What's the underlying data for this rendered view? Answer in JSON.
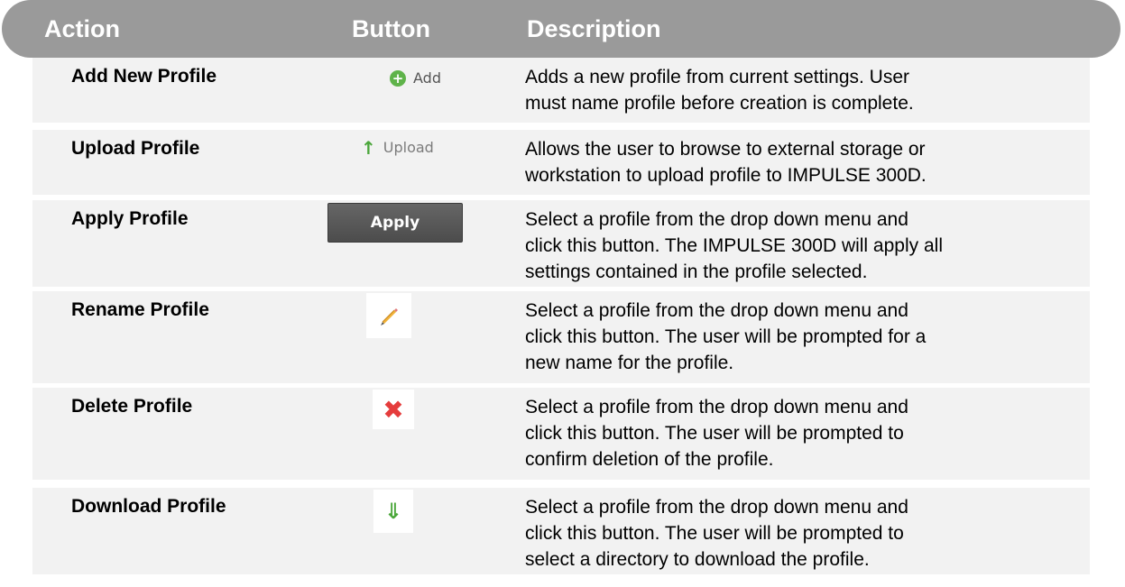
{
  "header": {
    "action": "Action",
    "button": "Button",
    "description": "Description"
  },
  "rows": [
    {
      "action": "Add New Profile",
      "button_label": "Add",
      "button_icon": "plus-circle-icon",
      "description": "Adds a new profile from current settings. User must name profile before creation is complete."
    },
    {
      "action": "Upload Profile",
      "button_label": "Upload",
      "button_icon": "arrow-up-icon",
      "description": "Allows the user to browse to external storage or workstation to upload profile to IMPULSE 300D."
    },
    {
      "action": "Apply Profile",
      "button_label": "Apply",
      "description": "Select a profile from the drop down menu and click this button. The IMPULSE 300D will apply all settings contained in the profile selected."
    },
    {
      "action": "Rename Profile",
      "button_icon": "pencil-icon",
      "description": "Select a profile from the drop down menu and click this button. The user will be prompted for a new name for the profile."
    },
    {
      "action": "Delete Profile",
      "button_icon": "delete-x-icon",
      "description": "Select a profile from the drop down menu and click this button. The user will be prompted to confirm deletion of the profile."
    },
    {
      "action": "Download Profile",
      "button_icon": "arrow-down-icon",
      "description": "Select a profile from the drop down menu and click this button. The user will be prompted to select a directory to download the profile."
    }
  ],
  "colors": {
    "header_bg": "#9a9a9a",
    "row_bg": "#f2f2f2",
    "icon_green": "#4aa63a",
    "icon_red": "#e53c3c"
  }
}
